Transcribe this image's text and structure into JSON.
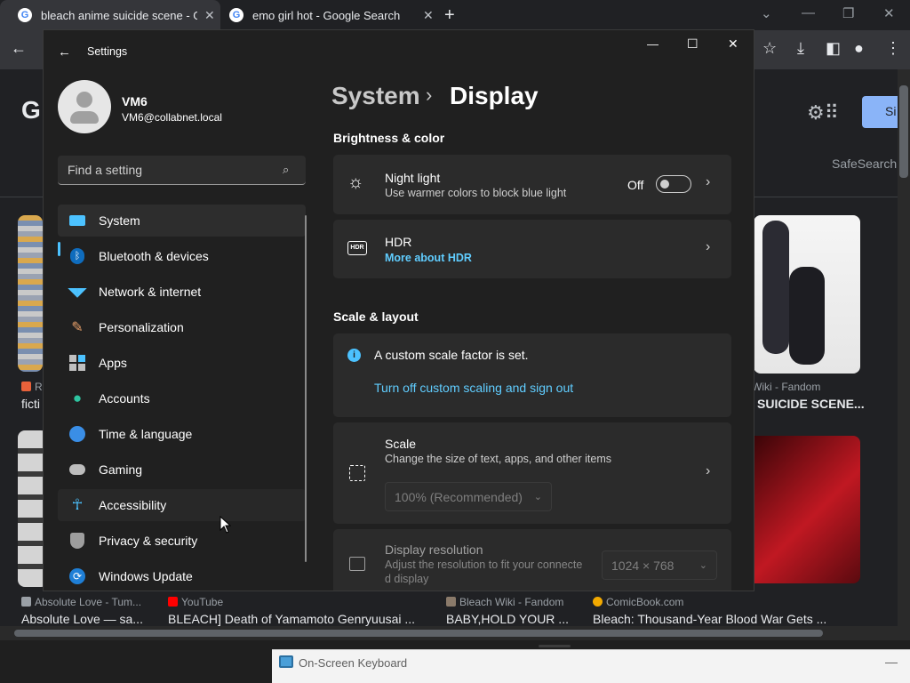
{
  "browser": {
    "tabs": [
      {
        "title": "bleach anime suicide scene - Google Search",
        "active": true
      },
      {
        "title": "emo girl hot - Google Search",
        "active": false
      }
    ],
    "new_tab": "+",
    "window_controls": {
      "dropdown": "⌄",
      "minimize": "—",
      "maximize": "❐",
      "close": "✕"
    },
    "toolbar": {
      "back": "←",
      "bookmark": "☆",
      "download": "⤓",
      "sidebar": "◧",
      "profile": "●",
      "menu": "⋮"
    }
  },
  "google_page": {
    "logo_fragment": "G",
    "sign_in_fragment": "Si",
    "safesearch": "SafeSearch",
    "results_row1": [
      {
        "source": "R",
        "title": "ficti"
      },
      {
        "source": "Wiki - Fandom",
        "title": "SUICIDE SCENE..."
      }
    ],
    "results_row2": [
      {
        "source": "Absolute Love - Tum...",
        "title": "Absolute Love — sa..."
      },
      {
        "source": "YouTube",
        "title": "BLEACH] Death of Yamamoto Genryuusai ..."
      },
      {
        "source": "Bleach Wiki - Fandom",
        "title": "BABY,HOLD YOUR ..."
      },
      {
        "source": "ComicBook.com",
        "title": "Bleach: Thousand-Year Blood War Gets ..."
      }
    ]
  },
  "settings": {
    "window_title": "Settings",
    "back": "←",
    "controls": {
      "minimize": "—",
      "maximize": "☐",
      "close": "✕"
    },
    "user": {
      "name": "VM6",
      "email": "VM6@collabnet.local"
    },
    "search_placeholder": "Find a setting",
    "nav": [
      {
        "label": "System",
        "icon": "system-icon",
        "selected": true
      },
      {
        "label": "Bluetooth & devices",
        "icon": "bluetooth-icon"
      },
      {
        "label": "Network & internet",
        "icon": "wifi-icon"
      },
      {
        "label": "Personalization",
        "icon": "brush-icon"
      },
      {
        "label": "Apps",
        "icon": "apps-icon"
      },
      {
        "label": "Accounts",
        "icon": "account-icon"
      },
      {
        "label": "Time & language",
        "icon": "globe-clock-icon"
      },
      {
        "label": "Gaming",
        "icon": "gamepad-icon"
      },
      {
        "label": "Accessibility",
        "icon": "accessibility-icon",
        "hovered": true
      },
      {
        "label": "Privacy & security",
        "icon": "shield-icon"
      },
      {
        "label": "Windows Update",
        "icon": "update-icon"
      }
    ],
    "breadcrumb": {
      "parent": "System",
      "separator": "›",
      "current": "Display"
    },
    "sections": {
      "brightness": "Brightness & color",
      "scale_layout": "Scale & layout"
    },
    "night_light": {
      "title": "Night light",
      "desc": "Use warmer colors to block blue light",
      "state": "Off",
      "on": false
    },
    "hdr": {
      "title": "HDR",
      "link": "More about HDR"
    },
    "custom_scale": {
      "message": "A custom scale factor is set.",
      "link": "Turn off custom scaling and sign out"
    },
    "scale": {
      "title": "Scale",
      "desc": "Change the size of text, apps, and other items",
      "value": "100% (Recommended)"
    },
    "resolution": {
      "title": "Display resolution",
      "desc_line1": "Adjust the resolution to fit your connecte",
      "desc_line2": "d display",
      "value": "1024 × 768"
    }
  },
  "osk": {
    "title": "On-Screen Keyboard",
    "minimize": "—"
  },
  "colors": {
    "accent": "#4cc2ff",
    "link": "#60cdff",
    "window_bg": "#202020",
    "card_bg": "#2b2b2b"
  }
}
